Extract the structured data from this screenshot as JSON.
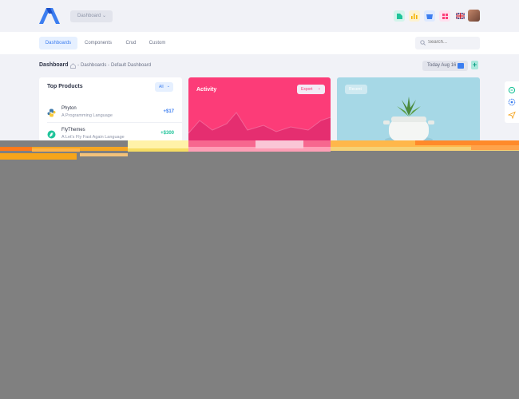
{
  "header": {
    "dashboard_select": "Dashboard",
    "icons": [
      "grid-icon",
      "bar-chart-icon",
      "bell-icon",
      "apps-icon",
      "uk-flag-icon"
    ]
  },
  "nav": {
    "tabs": [
      {
        "label": "Dashboards",
        "active": true
      },
      {
        "label": "Components",
        "active": false
      },
      {
        "label": "Crud",
        "active": false
      },
      {
        "label": "Custom",
        "active": false
      }
    ],
    "search_placeholder": "Search..."
  },
  "breadcrumb": {
    "title": "Dashboard",
    "items": [
      "Dashboards",
      "Default Dashboard"
    ],
    "separator": "-",
    "date_label": "Today Aug 16"
  },
  "top_products": {
    "title": "Top Products",
    "filter": "All",
    "items": [
      {
        "name": "Phyton",
        "desc": "A Programming Language",
        "value": "+$17",
        "color": "#3c7ef0"
      },
      {
        "name": "FlyThemes",
        "desc": "A Let's Fly Fast Again Language",
        "value": "+$300",
        "color": "#1fc49a"
      }
    ]
  },
  "activity": {
    "title": "Activity",
    "export_label": "Export",
    "color": "#fc3c78"
  },
  "recent": {
    "label": "Recent"
  },
  "colors": {
    "accent": "#3c7ef0",
    "pink": "#fc3c78",
    "teal": "#1fc49a"
  }
}
